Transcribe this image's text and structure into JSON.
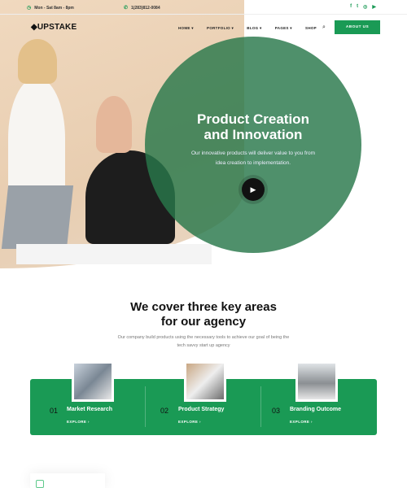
{
  "topbar": {
    "hours": "Mon - Sat 8am - 8pm",
    "phone": "1(283)812-0084",
    "social": [
      "facebook-icon",
      "twitter-icon",
      "instagram-icon",
      "youtube-icon"
    ]
  },
  "header": {
    "logo": "UPSTAKE",
    "nav": [
      "HOME ▾",
      "PORTFOLIO ▾",
      "BLOG ▾",
      "PAGES ▾",
      "SHOP"
    ],
    "cta": "ABOUT US"
  },
  "hero": {
    "title_line1": "Product Creation",
    "title_line2": "and Innovation",
    "subtitle": "Our innovative products will deliver value to you from idea creation to implementation."
  },
  "areas": {
    "title_line1": "We cover three key areas",
    "title_line2": "for our agency",
    "subtitle": "Our company build products using the necessary tools to achieve our goal of being the tech savvy start up agency",
    "items": [
      {
        "num": "01",
        "title": "Market Research",
        "link": "EXPLORE ›"
      },
      {
        "num": "02",
        "title": "Product Strategy",
        "link": "EXPLORE ›"
      },
      {
        "num": "03",
        "title": "Branding Outcome",
        "link": "EXPLORE ›"
      }
    ]
  },
  "colors": {
    "accent": "#1a9a55",
    "hero_circle": "#2f7d55"
  }
}
